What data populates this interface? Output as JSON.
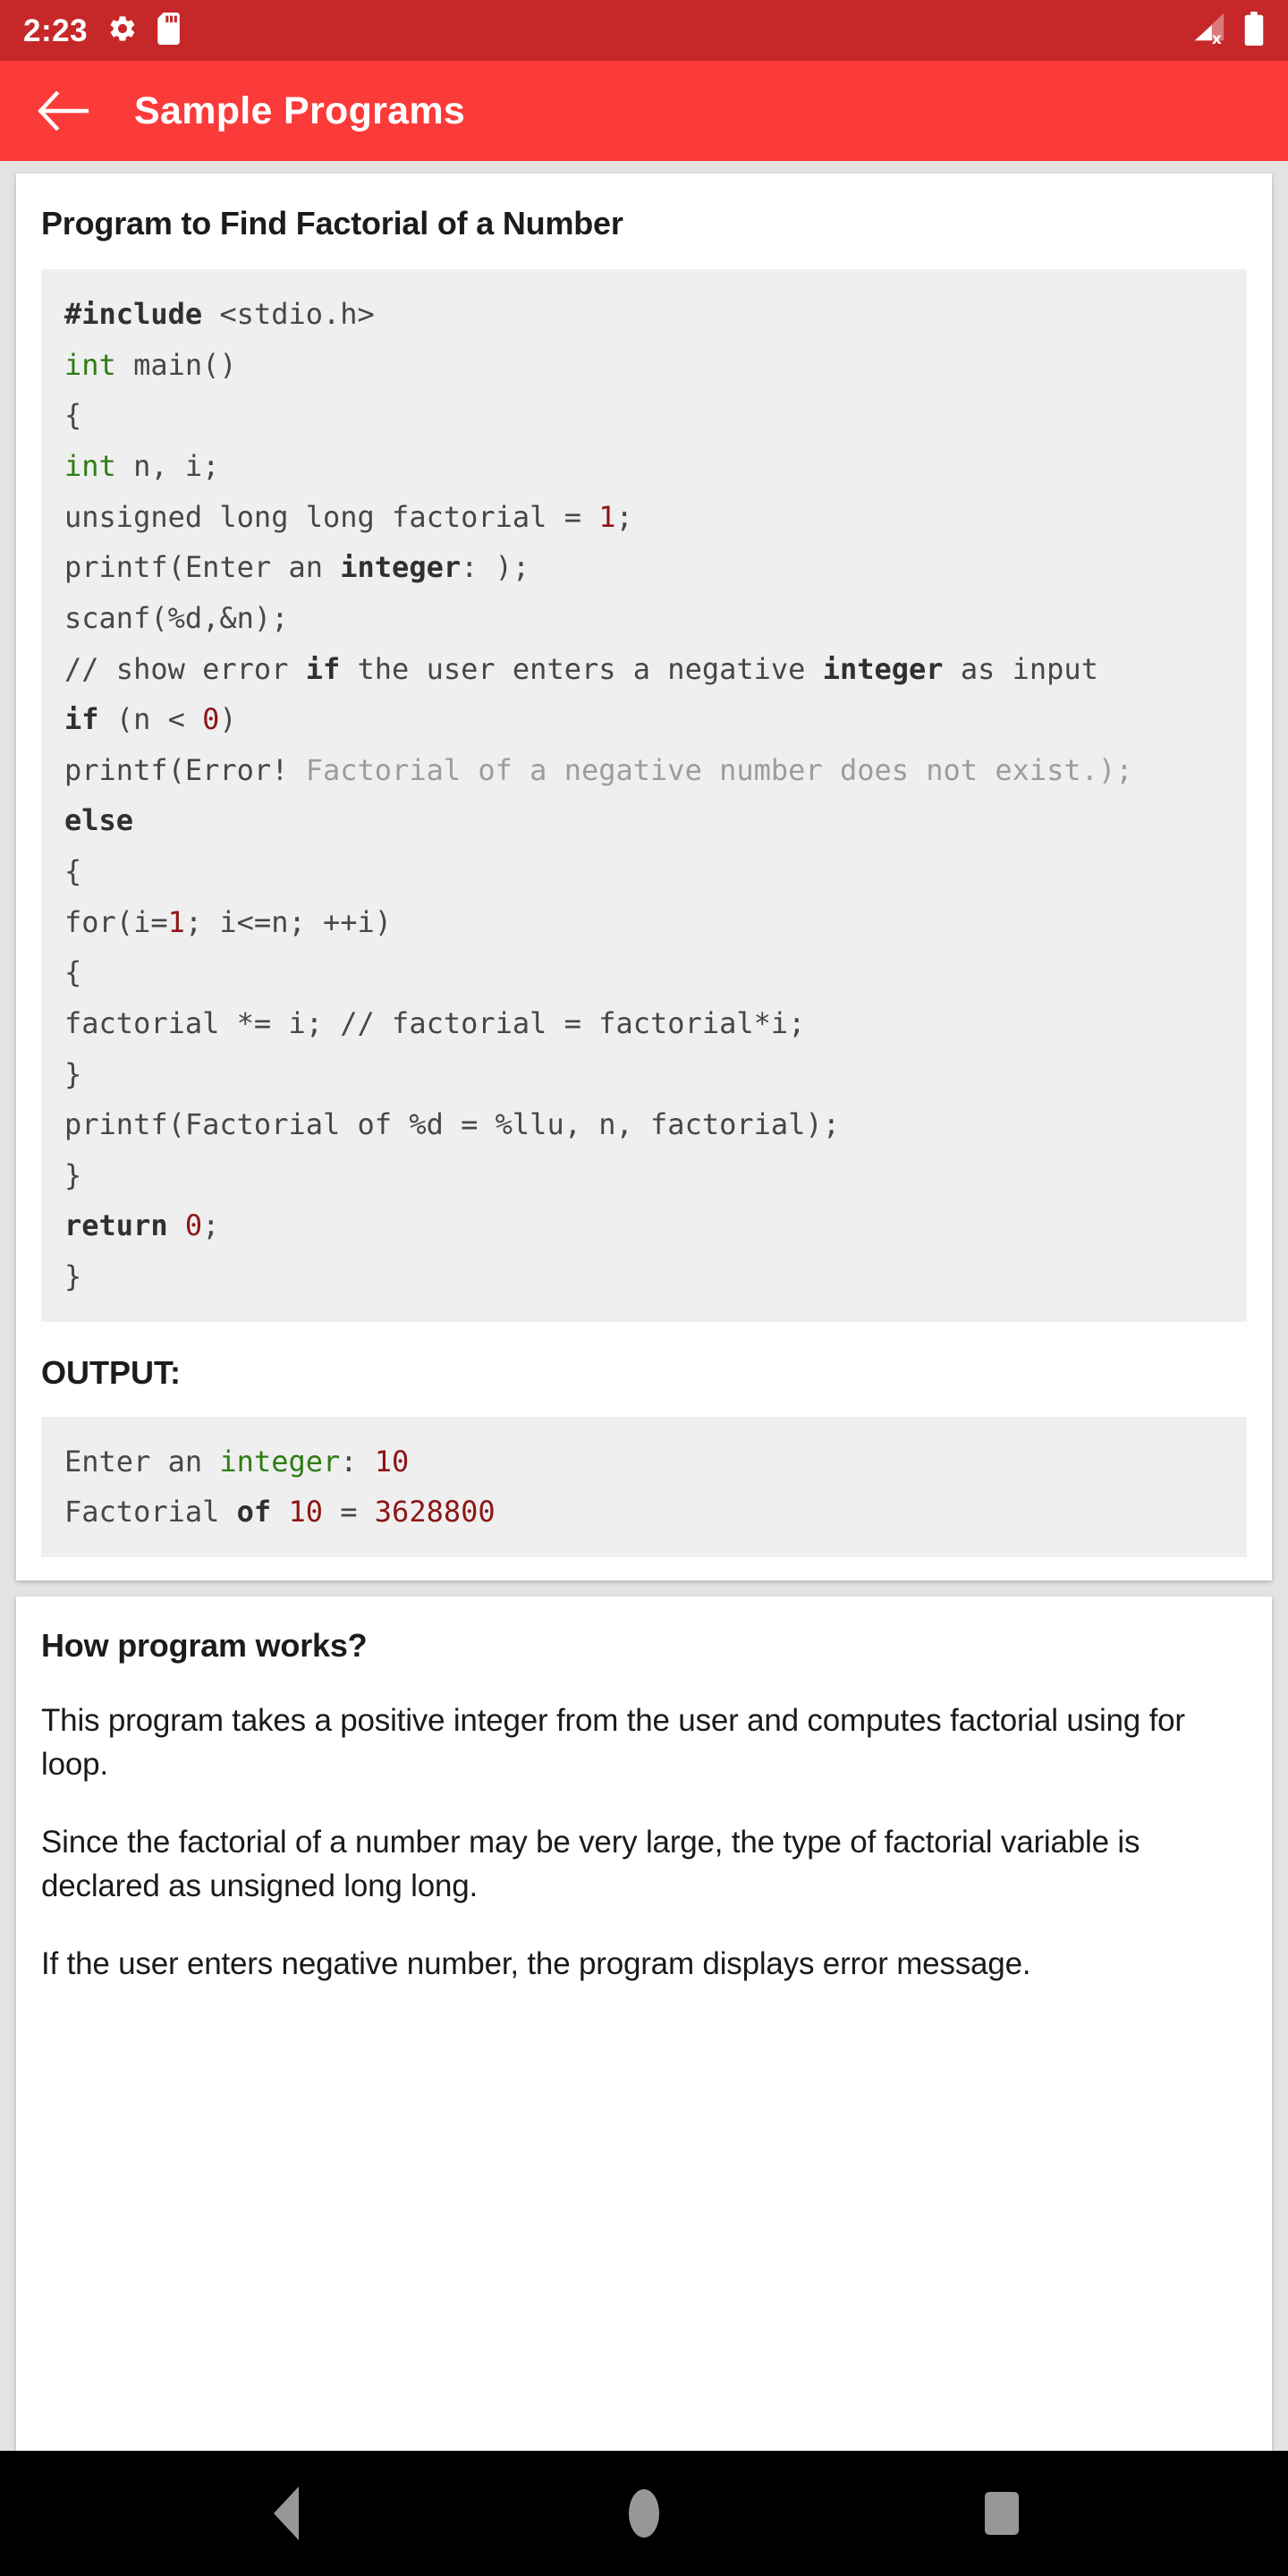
{
  "statusbar": {
    "time": "2:23",
    "icons": [
      "gear-icon",
      "sd-card-icon"
    ],
    "right_icons": [
      "signal-no-sim-icon",
      "battery-full-icon"
    ]
  },
  "appbar": {
    "back_label": "←",
    "title": "Sample Programs"
  },
  "program_card": {
    "title": "Program to Find Factorial of a Number",
    "code_lines": [
      [
        {
          "t": "#include ",
          "c": "pp"
        },
        {
          "t": "<stdio.h>",
          "c": "plain"
        }
      ],
      [
        {
          "t": "int",
          "c": "kw"
        },
        {
          "t": " main()",
          "c": "plain"
        }
      ],
      [
        {
          "t": "{",
          "c": "plain"
        }
      ],
      [
        {
          "t": "int",
          "c": "kw"
        },
        {
          "t": " n, i;",
          "c": "plain"
        }
      ],
      [
        {
          "t": "unsigned long long factorial = ",
          "c": "plain"
        },
        {
          "t": "1",
          "c": "num"
        },
        {
          "t": ";",
          "c": "plain"
        }
      ],
      [
        {
          "t": "printf(Enter an ",
          "c": "plain"
        },
        {
          "t": "integer",
          "c": "kw-b"
        },
        {
          "t": ": );",
          "c": "plain"
        }
      ],
      [
        {
          "t": "scanf(%d,&n);",
          "c": "plain"
        }
      ],
      [
        {
          "t": "// show error ",
          "c": "plain"
        },
        {
          "t": "if",
          "c": "kw-b"
        },
        {
          "t": " the user enters a negative ",
          "c": "plain"
        },
        {
          "t": "integer",
          "c": "kw-b"
        },
        {
          "t": " as input",
          "c": "plain"
        }
      ],
      [
        {
          "t": "if",
          "c": "kw-b"
        },
        {
          "t": " (n < ",
          "c": "plain"
        },
        {
          "t": "0",
          "c": "num"
        },
        {
          "t": ")",
          "c": "plain"
        }
      ],
      [
        {
          "t": "printf(Error! ",
          "c": "plain"
        },
        {
          "t": "Factorial of a negative number does not exist.);",
          "c": "dim"
        }
      ],
      [
        {
          "t": "else",
          "c": "kw-b"
        }
      ],
      [
        {
          "t": "{",
          "c": "plain"
        }
      ],
      [
        {
          "t": "for(i=",
          "c": "plain"
        },
        {
          "t": "1",
          "c": "num"
        },
        {
          "t": "; i<=n; ++i)",
          "c": "plain"
        }
      ],
      [
        {
          "t": "{",
          "c": "plain"
        }
      ],
      [
        {
          "t": "factorial *= i; // factorial = factorial*i;",
          "c": "plain"
        }
      ],
      [
        {
          "t": "}",
          "c": "plain"
        }
      ],
      [
        {
          "t": "printf(Factorial of %d = %llu, n, factorial);",
          "c": "plain"
        }
      ],
      [
        {
          "t": "}",
          "c": "plain"
        }
      ],
      [
        {
          "t": "return",
          "c": "kw-b"
        },
        {
          "t": " ",
          "c": "plain"
        },
        {
          "t": "0",
          "c": "num"
        },
        {
          "t": ";",
          "c": "plain"
        }
      ],
      [
        {
          "t": "}",
          "c": "plain"
        }
      ]
    ],
    "output_label": "OUTPUT:",
    "output_lines": [
      [
        {
          "t": "Enter an ",
          "c": "plain"
        },
        {
          "t": "integer",
          "c": "kw"
        },
        {
          "t": ": ",
          "c": "plain"
        },
        {
          "t": "10",
          "c": "num"
        }
      ],
      [
        {
          "t": "Factorial ",
          "c": "plain"
        },
        {
          "t": "of",
          "c": "kw-b"
        },
        {
          "t": " ",
          "c": "plain"
        },
        {
          "t": "10",
          "c": "num"
        },
        {
          "t": " = ",
          "c": "plain"
        },
        {
          "t": "3628800",
          "c": "num"
        }
      ]
    ]
  },
  "explain_card": {
    "title": "How program works?",
    "paragraphs": [
      "This program takes a positive integer from the user and computes factorial using for loop.",
      "Since the factorial of a number may be very large, the type of factorial variable is declared as unsigned long long.",
      "If the user enters negative number, the program displays error message."
    ]
  },
  "navbar": {
    "back": "nav-back-icon",
    "home": "nav-home-icon",
    "recents": "nav-recents-icon"
  },
  "colors": {
    "statusbar_bg": "#c6282a",
    "appbar_bg": "#fb3b39",
    "page_bg": "#e3e3e3",
    "code_bg": "#efeff0",
    "keyword": "#2e7d12",
    "number": "#8c1616",
    "dim": "#9c9c9c"
  }
}
